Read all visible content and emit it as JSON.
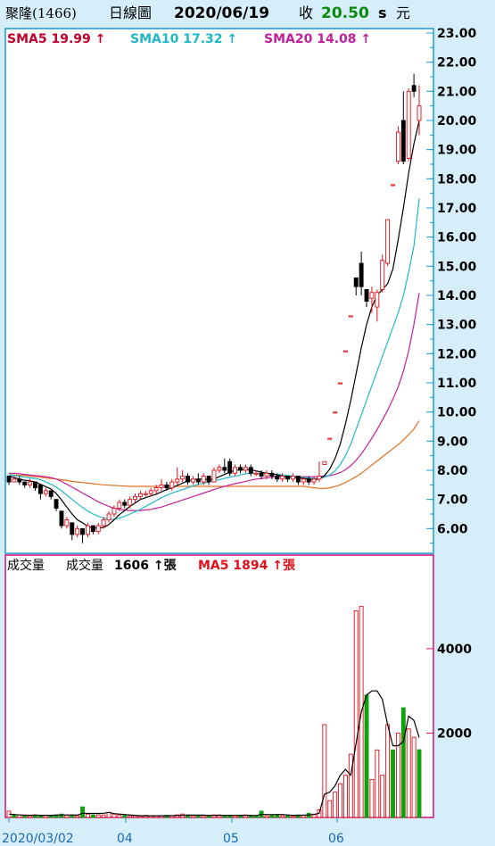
{
  "header": {
    "name": "聚隆(1466)",
    "chart_type": "日線圖",
    "date": "2020/06/19",
    "close_label": "收",
    "close": "20.50",
    "unit1": "s",
    "unit2": "元"
  },
  "price_legend": [
    {
      "label": "SMA5",
      "value": "19.99",
      "arrow": "↑",
      "color": "#c0002a"
    },
    {
      "label": "SMA10",
      "value": "17.32",
      "arrow": "↑",
      "color": "#20b8c8"
    },
    {
      "label": "SMA20",
      "value": "14.08",
      "arrow": "↑",
      "color": "#c0209a"
    }
  ],
  "volume_legend": {
    "title": "成交量",
    "label": "成交量",
    "value": "1606",
    "arrow": "↑",
    "unit": "張",
    "ma_label": "MA5",
    "ma_value": "1894",
    "ma_arrow": "↑",
    "ma_unit": "張"
  },
  "colors": {
    "up": "#e0101a",
    "down": "#000000",
    "sma5": "#000000",
    "sma10": "#20b8c8",
    "sma20": "#c0209a",
    "long_ma": "#e07020",
    "vol_up": "#e0101a",
    "vol_down": "#10a010",
    "panel_border": "#d0107a"
  },
  "chart_data": [
    {
      "type": "candlestick",
      "x_ticks": [
        "2020/03/02",
        "04",
        "05",
        "06"
      ],
      "ylim": [
        5.0,
        23.0
      ],
      "y_ticks": [
        "6.00",
        "7.00",
        "8.00",
        "9.00",
        "10.00",
        "11.00",
        "12.00",
        "13.00",
        "14.00",
        "15.00",
        "16.00",
        "17.00",
        "18.00",
        "19.00",
        "20.00",
        "21.00",
        "22.00",
        "23.00"
      ],
      "candles": [
        [
          7.8,
          7.6,
          7.8,
          7.5
        ],
        [
          7.6,
          7.7,
          7.8,
          7.6
        ],
        [
          7.7,
          7.6,
          7.8,
          7.5
        ],
        [
          7.6,
          7.5,
          7.6,
          7.4
        ],
        [
          7.5,
          7.6,
          7.7,
          7.4
        ],
        [
          7.6,
          7.4,
          7.6,
          7.3
        ],
        [
          7.5,
          7.2,
          7.5,
          7.0
        ],
        [
          7.2,
          7.3,
          7.4,
          7.1
        ],
        [
          7.3,
          7.1,
          7.3,
          7.0
        ],
        [
          7.0,
          6.7,
          7.0,
          6.6
        ],
        [
          6.6,
          6.1,
          6.6,
          6.0
        ],
        [
          6.1,
          6.3,
          6.4,
          6.0
        ],
        [
          6.2,
          5.8,
          6.2,
          5.6
        ],
        [
          5.8,
          6.0,
          6.1,
          5.7
        ],
        [
          6.0,
          5.8,
          6.0,
          5.5
        ],
        [
          5.8,
          6.1,
          6.2,
          5.7
        ],
        [
          6.1,
          5.9,
          6.1,
          5.8
        ],
        [
          5.9,
          6.1,
          6.2,
          5.8
        ],
        [
          6.1,
          6.3,
          6.4,
          6.0
        ],
        [
          6.3,
          6.5,
          6.6,
          6.2
        ],
        [
          6.5,
          6.7,
          6.8,
          6.4
        ],
        [
          6.7,
          6.9,
          7.0,
          6.6
        ],
        [
          6.9,
          6.8,
          7.0,
          6.7
        ],
        [
          6.8,
          7.0,
          7.1,
          6.7
        ],
        [
          7.0,
          7.1,
          7.2,
          6.9
        ],
        [
          7.1,
          7.2,
          7.3,
          7.0
        ],
        [
          7.2,
          7.2,
          7.3,
          7.1
        ],
        [
          7.2,
          7.3,
          7.4,
          7.1
        ],
        [
          7.3,
          7.4,
          7.5,
          7.2
        ],
        [
          7.4,
          7.5,
          7.7,
          7.3
        ],
        [
          7.5,
          7.4,
          7.6,
          7.3
        ],
        [
          7.4,
          7.6,
          7.7,
          7.3
        ],
        [
          7.6,
          7.7,
          8.1,
          7.5
        ],
        [
          7.7,
          7.8,
          8.0,
          7.6
        ],
        [
          7.8,
          7.6,
          7.9,
          7.5
        ],
        [
          7.6,
          7.7,
          7.8,
          7.5
        ],
        [
          7.7,
          7.6,
          7.9,
          7.5
        ],
        [
          7.6,
          7.8,
          7.9,
          7.5
        ],
        [
          7.8,
          7.6,
          7.8,
          7.5
        ],
        [
          7.6,
          8.0,
          8.1,
          7.6
        ],
        [
          8.0,
          8.1,
          8.2,
          7.9
        ],
        [
          8.1,
          8.0,
          8.4,
          7.9
        ],
        [
          8.3,
          7.9,
          8.4,
          7.8
        ],
        [
          7.9,
          8.1,
          8.2,
          7.8
        ],
        [
          8.1,
          8.0,
          8.2,
          7.9
        ],
        [
          8.0,
          8.1,
          8.2,
          7.9
        ],
        [
          8.1,
          7.9,
          8.2,
          7.8
        ],
        [
          7.9,
          7.9,
          8.0,
          7.8
        ],
        [
          7.9,
          7.8,
          8.0,
          7.7
        ],
        [
          7.8,
          7.9,
          8.0,
          7.7
        ],
        [
          7.9,
          7.8,
          8.0,
          7.7
        ],
        [
          7.8,
          7.7,
          7.9,
          7.6
        ],
        [
          7.7,
          7.8,
          7.9,
          7.6
        ],
        [
          7.8,
          7.7,
          7.8,
          7.6
        ],
        [
          7.7,
          7.8,
          7.9,
          7.6
        ],
        [
          7.8,
          7.6,
          7.8,
          7.5
        ],
        [
          7.6,
          7.7,
          7.8,
          7.5
        ],
        [
          7.7,
          7.6,
          7.8,
          7.5
        ],
        [
          7.6,
          7.7,
          7.8,
          7.5
        ],
        [
          7.7,
          7.8,
          8.3,
          7.6
        ],
        [
          8.2,
          8.3,
          8.3,
          8.2
        ],
        [
          9.1,
          9.1,
          9.1,
          9.1
        ],
        [
          10.0,
          10.0,
          10.0,
          10.0
        ],
        [
          11.0,
          11.0,
          11.0,
          11.0
        ],
        [
          12.1,
          12.1,
          12.1,
          12.1
        ],
        [
          13.3,
          13.3,
          13.3,
          13.3
        ],
        [
          14.6,
          14.3,
          14.6,
          14.0
        ],
        [
          15.1,
          14.3,
          15.5,
          14.0
        ],
        [
          14.2,
          13.8,
          14.2,
          13.6
        ],
        [
          13.9,
          14.1,
          14.3,
          13.4
        ],
        [
          13.6,
          14.1,
          14.2,
          13.1
        ],
        [
          14.2,
          15.2,
          15.4,
          14.1
        ],
        [
          15.1,
          16.6,
          16.6,
          15.0
        ],
        [
          17.8,
          17.8,
          17.8,
          17.8
        ],
        [
          18.6,
          19.6,
          19.8,
          18.5
        ],
        [
          20.0,
          18.6,
          21.0,
          18.5
        ],
        [
          18.7,
          21.0,
          21.1,
          18.6
        ],
        [
          21.2,
          21.0,
          21.6,
          20.8
        ],
        [
          20.0,
          20.5,
          21.2,
          19.5
        ]
      ],
      "sma5": [
        7.8,
        7.75,
        7.7,
        7.66,
        7.64,
        7.6,
        7.52,
        7.44,
        7.36,
        7.2,
        6.98,
        6.74,
        6.5,
        6.3,
        6.2,
        6.08,
        6.02,
        6.02,
        6.04,
        6.14,
        6.3,
        6.48,
        6.62,
        6.76,
        6.88,
        7.0,
        7.06,
        7.12,
        7.18,
        7.26,
        7.34,
        7.4,
        7.48,
        7.56,
        7.64,
        7.68,
        7.7,
        7.7,
        7.68,
        7.7,
        7.78,
        7.86,
        7.94,
        8.0,
        8.02,
        8.02,
        8.02,
        7.98,
        7.94,
        7.9,
        7.88,
        7.84,
        7.8,
        7.76,
        7.76,
        7.74,
        7.72,
        7.7,
        7.68,
        7.7,
        7.82,
        8.04,
        8.4,
        8.9,
        9.6,
        10.4,
        11.3,
        12.2,
        13.0,
        13.6,
        14.0,
        14.2,
        14.4,
        14.9,
        15.9,
        17.0,
        18.2,
        19.2,
        19.99
      ],
      "sma10": [
        7.85,
        7.82,
        7.8,
        7.76,
        7.74,
        7.72,
        7.68,
        7.6,
        7.52,
        7.42,
        7.3,
        7.15,
        7.0,
        6.86,
        6.72,
        6.6,
        6.5,
        6.42,
        6.36,
        6.32,
        6.32,
        6.36,
        6.42,
        6.5,
        6.58,
        6.66,
        6.76,
        6.86,
        6.96,
        7.06,
        7.14,
        7.22,
        7.28,
        7.34,
        7.4,
        7.46,
        7.52,
        7.56,
        7.6,
        7.64,
        7.68,
        7.72,
        7.76,
        7.8,
        7.84,
        7.88,
        7.9,
        7.9,
        7.9,
        7.9,
        7.88,
        7.86,
        7.84,
        7.82,
        7.8,
        7.78,
        7.76,
        7.74,
        7.72,
        7.72,
        7.76,
        7.84,
        7.98,
        8.2,
        8.5,
        8.9,
        9.4,
        9.9,
        10.4,
        10.9,
        11.4,
        11.9,
        12.4,
        12.9,
        13.4,
        14.0,
        14.8,
        15.7,
        17.32
      ],
      "sma20": [
        7.9,
        7.9,
        7.88,
        7.86,
        7.84,
        7.82,
        7.8,
        7.78,
        7.75,
        7.7,
        7.62,
        7.52,
        7.42,
        7.32,
        7.22,
        7.12,
        7.02,
        6.92,
        6.84,
        6.76,
        6.7,
        6.66,
        6.64,
        6.62,
        6.62,
        6.62,
        6.64,
        6.66,
        6.7,
        6.74,
        6.8,
        6.86,
        6.92,
        6.98,
        7.04,
        7.1,
        7.16,
        7.22,
        7.28,
        7.34,
        7.4,
        7.45,
        7.5,
        7.54,
        7.58,
        7.62,
        7.66,
        7.7,
        7.72,
        7.74,
        7.76,
        7.78,
        7.78,
        7.78,
        7.78,
        7.78,
        7.78,
        7.78,
        7.78,
        7.78,
        7.8,
        7.82,
        7.86,
        7.92,
        8.02,
        8.16,
        8.34,
        8.56,
        8.82,
        9.1,
        9.4,
        9.72,
        10.06,
        10.44,
        10.86,
        11.4,
        12.1,
        13.0,
        14.08
      ],
      "long_ma": [
        7.85,
        7.84,
        7.83,
        7.82,
        7.8,
        7.78,
        7.76,
        7.74,
        7.72,
        7.7,
        7.68,
        7.65,
        7.62,
        7.6,
        7.58,
        7.56,
        7.54,
        7.52,
        7.5,
        7.49,
        7.48,
        7.47,
        7.46,
        7.45,
        7.45,
        7.45,
        7.45,
        7.45,
        7.45,
        7.45,
        7.45,
        7.45,
        7.45,
        7.45,
        7.45,
        7.45,
        7.45,
        7.45,
        7.45,
        7.45,
        7.45,
        7.45,
        7.45,
        7.45,
        7.45,
        7.45,
        7.45,
        7.45,
        7.45,
        7.45,
        7.45,
        7.45,
        7.45,
        7.45,
        7.45,
        7.45,
        7.45,
        7.42,
        7.4,
        7.38,
        7.38,
        7.4,
        7.44,
        7.5,
        7.58,
        7.68,
        7.78,
        7.9,
        8.04,
        8.18,
        8.32,
        8.46,
        8.6,
        8.74,
        8.88,
        9.04,
        9.22,
        9.42,
        9.7
      ]
    },
    {
      "type": "bar",
      "ylim": [
        0,
        5500
      ],
      "y_ticks": [
        "2000",
        "4000"
      ],
      "volume": [
        150,
        60,
        60,
        50,
        40,
        60,
        50,
        50,
        40,
        60,
        80,
        50,
        60,
        40,
        250,
        80,
        60,
        60,
        60,
        120,
        80,
        60,
        50,
        40,
        40,
        30,
        50,
        40,
        40,
        40,
        50,
        40,
        60,
        80,
        60,
        40,
        50,
        40,
        30,
        60,
        60,
        40,
        50,
        40,
        40,
        60,
        50,
        40,
        150,
        40,
        50,
        60,
        40,
        40,
        30,
        60,
        50,
        100,
        80,
        180,
        2200,
        400,
        600,
        800,
        1000,
        1500,
        4900,
        5000,
        2900,
        900,
        1600,
        1000,
        2200,
        1600,
        2000,
        2600,
        2100,
        1900,
        1606
      ],
      "volume_up": [
        true,
        false,
        true,
        false,
        true,
        false,
        false,
        true,
        false,
        false,
        false,
        true,
        false,
        true,
        false,
        true,
        false,
        true,
        true,
        true,
        true,
        true,
        false,
        true,
        true,
        true,
        true,
        true,
        true,
        true,
        false,
        true,
        true,
        true,
        false,
        true,
        false,
        true,
        false,
        true,
        true,
        false,
        false,
        true,
        false,
        true,
        false,
        false,
        false,
        true,
        false,
        false,
        true,
        false,
        true,
        false,
        true,
        false,
        true,
        true,
        true,
        true,
        true,
        true,
        true,
        true,
        true,
        true,
        false,
        true,
        true,
        true,
        true,
        false,
        true,
        false,
        true,
        true,
        false
      ],
      "ma5": [
        80,
        70,
        60,
        55,
        50,
        55,
        50,
        50,
        50,
        55,
        60,
        60,
        60,
        55,
        100,
        95,
        95,
        95,
        100,
        120,
        90,
        80,
        70,
        60,
        50,
        40,
        40,
        40,
        40,
        40,
        42,
        42,
        46,
        50,
        55,
        56,
        58,
        54,
        48,
        50,
        50,
        48,
        50,
        48,
        50,
        50,
        48,
        46,
        70,
        70,
        68,
        70,
        70,
        60,
        50,
        50,
        56,
        60,
        70,
        100,
        550,
        600,
        750,
        1000,
        1140,
        1000,
        1750,
        2500,
        2900,
        3000,
        3000,
        2800,
        2200,
        1700,
        1700,
        1800,
        2400,
        2300,
        1894
      ]
    }
  ]
}
